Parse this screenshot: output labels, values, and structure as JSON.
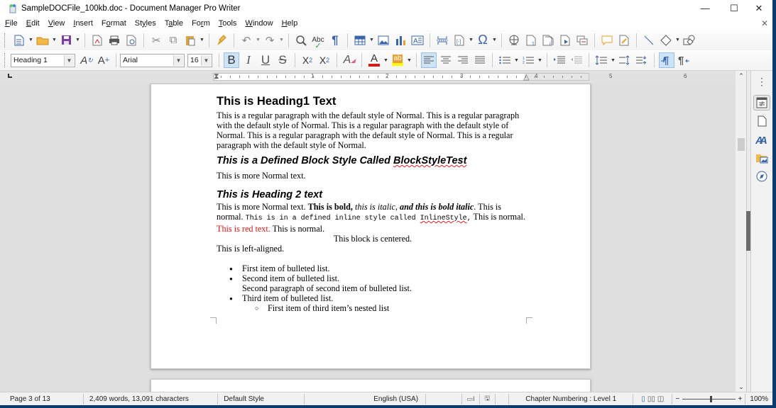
{
  "window": {
    "title": "SampleDOCFile_100kb.doc - Document Manager Pro Writer",
    "controls": {
      "minimize": "—",
      "maximize": "☐",
      "close": "✕"
    },
    "doc_close": "✕"
  },
  "menubar": [
    {
      "accel": "F",
      "rest": "ile"
    },
    {
      "accel": "E",
      "rest": "dit"
    },
    {
      "accel": "V",
      "rest": "iew"
    },
    {
      "accel": "I",
      "rest": "nsert"
    },
    {
      "pre": "F",
      "accel": "o",
      "rest": "rmat"
    },
    {
      "pre": "St",
      "accel": "y",
      "rest": "les"
    },
    {
      "pre": "T",
      "accel": "a",
      "rest": "ble"
    },
    {
      "pre": "Fo",
      "accel": "r",
      "rest": "m"
    },
    {
      "accel": "T",
      "rest": "ools"
    },
    {
      "accel": "W",
      "rest": "indow"
    },
    {
      "accel": "H",
      "rest": "elp"
    }
  ],
  "formatting": {
    "paragraph_style": "Heading 1",
    "font_name": "Arial",
    "font_size": "16",
    "bold_active": true,
    "align_left_active": true,
    "formatting_marks_active": true,
    "font_color": "#d01c1c",
    "highlight_color": "#ffff00"
  },
  "icons": {
    "new": "🗎",
    "open": "📂",
    "save": "💾",
    "export_pdf": "🗋",
    "print": "🖶",
    "print_preview": "🔍",
    "cut": "✂",
    "copy": "⧉",
    "paste": "📋",
    "clone": "🖌",
    "undo": "↶",
    "redo": "↷",
    "find": "🔎",
    "spelling": "ᴬᵇᶜ",
    "formatting_marks": "¶",
    "table": "▦",
    "image": "🖼",
    "chart": "📊",
    "textbox": "A≡",
    "page_break": "⇹",
    "field": "⊡",
    "special_char": "Ω",
    "hyperlink": "🌐",
    "footnote": "▯",
    "endnote": "▯",
    "bookmark": "▶",
    "cross_ref": "⧉",
    "comment": "💬",
    "track_changes": "✎",
    "line": "╲",
    "shapes": "◇",
    "draw": "⬡",
    "update_style": "A",
    "new_style": "A+",
    "bold": "B",
    "italic": "I",
    "underline": "U",
    "strikethrough": "S",
    "superscript": "X²",
    "subscript": "X₂",
    "clear_formatting": "A",
    "font_color": "A",
    "highlight": "ab",
    "align_left": "≡",
    "align_center": "≡",
    "align_right": "≡",
    "justify": "≡",
    "bullets": "☰",
    "numbering": "☰",
    "increase_indent": "⇥",
    "decrease_indent": "⇤",
    "line_spacing": "↕",
    "para_spacing_inc": "⇡",
    "para_spacing_dec": "⇣",
    "ltr": "¶",
    "rtl": "¶"
  },
  "ruler": {
    "labels": [
      "1",
      "2",
      "3",
      "4",
      "5",
      "6"
    ]
  },
  "document": {
    "heading1": "This is Heading1 Text",
    "para1": "This is a regular paragraph with the default style of Normal. This is a regular paragraph with the default style of Normal. This is a regular paragraph with the default style of Normal. This is a regular paragraph with the default style of Normal. This is a regular paragraph with the default style of Normal.",
    "block_heading_pre": "This is a Defined Block Style Called ",
    "block_heading_misspelled": "BlockStyleTest",
    "para2": "This is more Normal text.",
    "heading2": "This is Heading 2 text",
    "mixed": {
      "normal1": "This is more Normal text. ",
      "bold": "This is bold,",
      "space1": " ",
      "italic": "this is italic",
      "comma": ", ",
      "bold_italic": "and this is bold italic",
      "normal2": ". This is normal. ",
      "mono_pre": "This is in a defined inline style called ",
      "mono_misspelled": "InlineStyle",
      "mono_post": ",",
      "normal3": " This is normal. ",
      "red": "This is red text.",
      "normal4": " This is normal."
    },
    "centered": "This block is centered.",
    "left_aligned": "This is left-aligned.",
    "bullets": [
      {
        "text": "First item of bulleted list."
      },
      {
        "text": "Second item of bulleted list.",
        "second_para": "Second paragraph of second item of bulleted list."
      },
      {
        "text": "Third item of bulleted list.",
        "nested": [
          "First item of third item’s nested list"
        ]
      }
    ],
    "bullet_glyph": "●",
    "nested_glyph": "○"
  },
  "sidebar": {
    "more": "⋮",
    "buttons": [
      {
        "name": "properties",
        "glyph": "☷"
      },
      {
        "name": "page",
        "glyph": "🗋"
      },
      {
        "name": "styles",
        "glyph": "A"
      },
      {
        "name": "gallery",
        "glyph": "🖼"
      },
      {
        "name": "navigator",
        "glyph": "⊘"
      }
    ]
  },
  "scrollbar": {
    "up": "⌃",
    "down": "⌄",
    "position_fraction": 0.2
  },
  "statusbar": {
    "page": "Page 3 of 13",
    "word_count": "2,409 words, 13,091 characters",
    "page_style": "Default Style",
    "language": "English (USA)",
    "selection_mode": "▭I",
    "doc_modified": "🖫",
    "outline": "Chapter Numbering : Level 1",
    "view_single": "▯",
    "view_multi": "▯▯",
    "view_book": "◫",
    "zoom_minus": "−",
    "zoom_plus": "+",
    "zoom": "100%",
    "zoom_fraction": 0.5
  }
}
